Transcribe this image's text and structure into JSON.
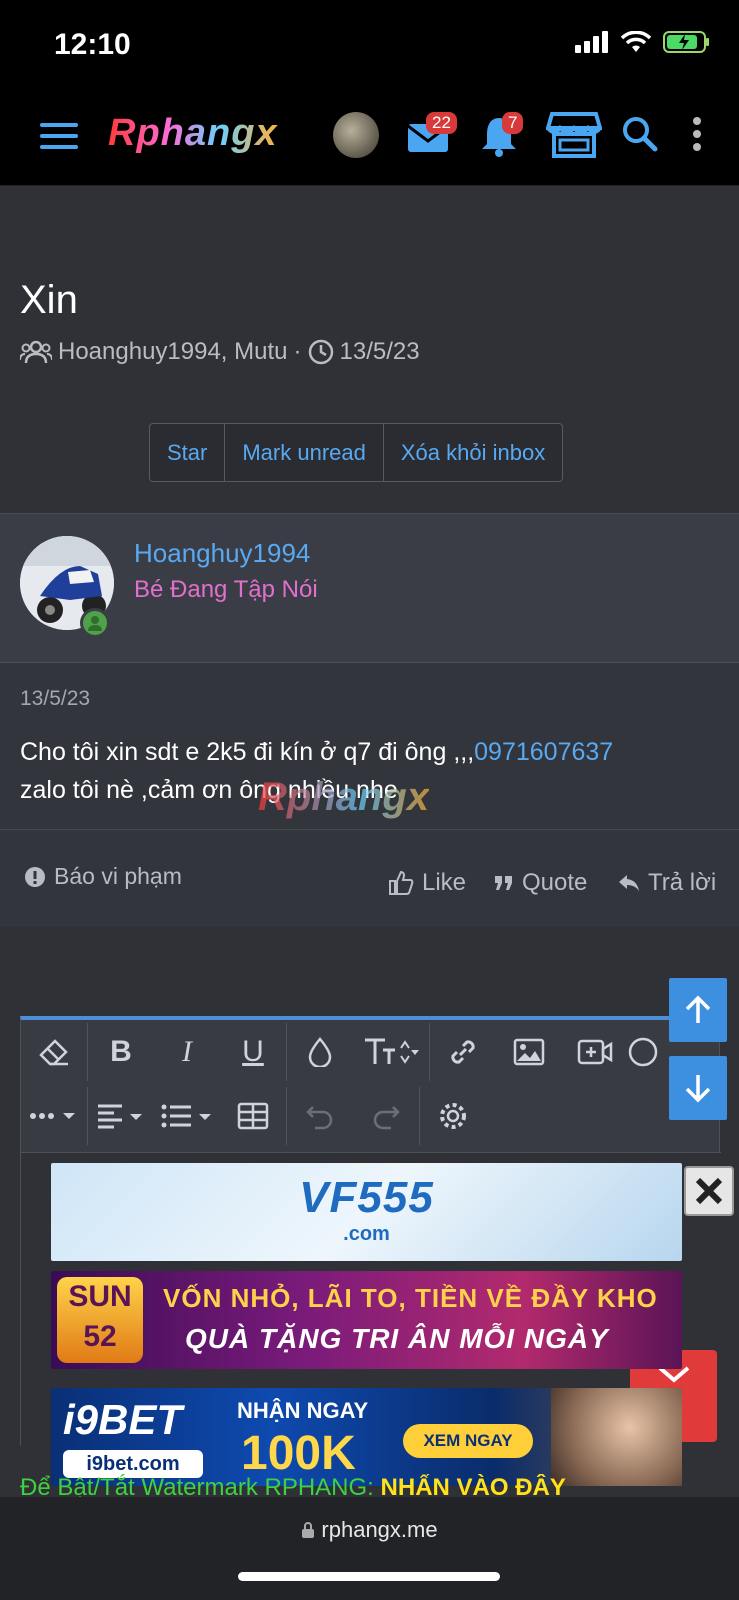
{
  "status": {
    "time": "12:10"
  },
  "header": {
    "logo": "Rphangx",
    "inbox_count": "22",
    "alerts_count": "7"
  },
  "thread": {
    "title": "Xin",
    "participants": "Hoanghuy1994, Mutu",
    "separator": "·",
    "date": "13/5/23",
    "actions": {
      "star": "Star",
      "mark_unread": "Mark unread",
      "remove_inbox": "Xóa khỏi inbox"
    }
  },
  "message": {
    "username": "Hoanghuy1994",
    "rank": "Bé Đang Tập Nói",
    "date": "13/5/23",
    "text_before": "Cho tôi xin sdt e 2k5 đi kín ở q7 đi ông ,,,",
    "phone_link": "0971607637",
    "text_after": "zalo tôi nè ,cảm ơn ông nhiều nhe",
    "watermark": "Rphangx",
    "report": "Báo vi phạm",
    "like": "Like",
    "quote": "Quote",
    "reply": "Trả lời"
  },
  "ads": {
    "ad1_brand": "VF555",
    "ad1_domain": ".com",
    "ad2_badge": "SUN 52",
    "ad2_line1": "VỐN NHỎ, LÃI TO, TIỀN VỀ ĐẦY KHO",
    "ad2_line2": "QUÀ TẶNG TRI ÂN MỖI NGÀY",
    "ad3_brand": "i9BET",
    "ad3_site": "i9bet.com",
    "ad3_line1": "NHẬN NGAY",
    "ad3_amount": "100K",
    "ad3_cta": "XEM NGAY"
  },
  "footer": {
    "watermark_note": "Để Bật/Tắt Watermark RPHANG:",
    "watermark_cta": "NHẤN VÀO ĐÂY"
  },
  "browser": {
    "url": "rphangx.me"
  }
}
